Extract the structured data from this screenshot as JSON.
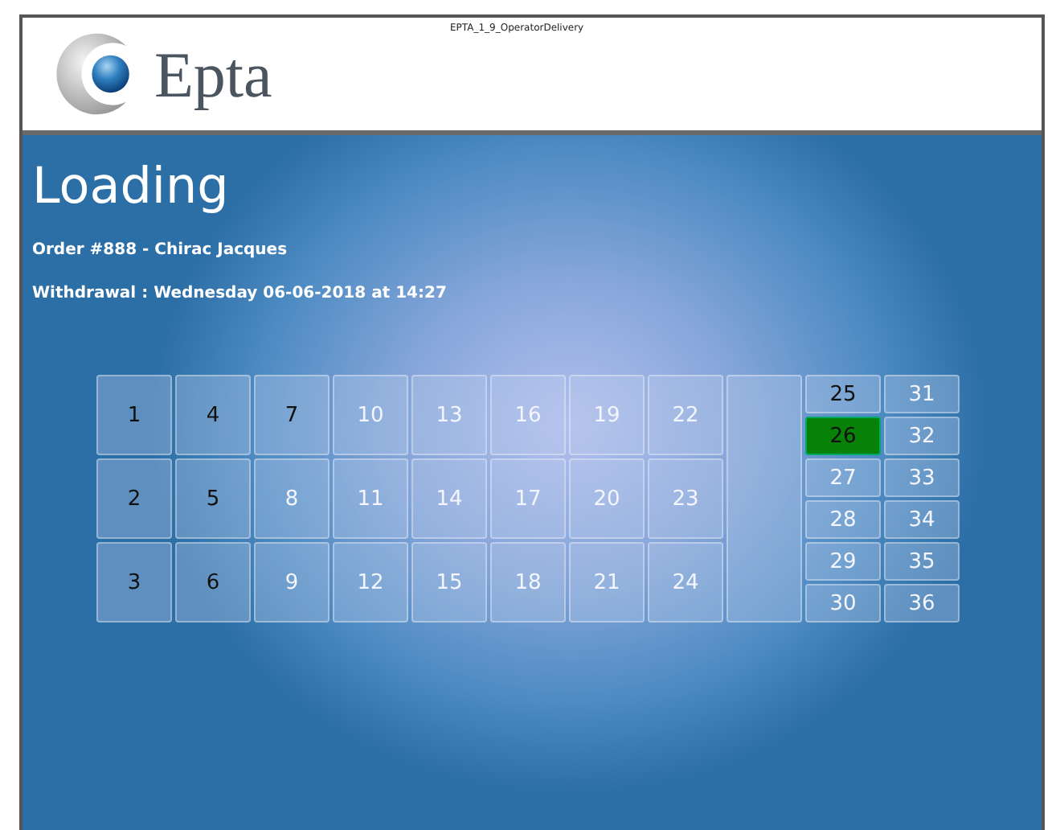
{
  "window": {
    "title": "EPTA_1_9_OperatorDelivery"
  },
  "logo": {
    "text": "Epta"
  },
  "page": {
    "title": "Loading",
    "order": "Order #888 - Chirac Jacques",
    "withdrawal": "Withdrawal : Wednesday 06-06-2018 at 14:27"
  },
  "large_lockers": [
    {
      "label": "1",
      "active": true,
      "selected": false
    },
    {
      "label": "2",
      "active": true,
      "selected": false
    },
    {
      "label": "3",
      "active": true,
      "selected": false
    },
    {
      "label": "4",
      "active": true,
      "selected": false
    },
    {
      "label": "5",
      "active": true,
      "selected": false
    },
    {
      "label": "6",
      "active": true,
      "selected": false
    },
    {
      "label": "7",
      "active": true,
      "selected": false
    },
    {
      "label": "8",
      "active": false,
      "selected": false
    },
    {
      "label": "9",
      "active": false,
      "selected": false
    },
    {
      "label": "10",
      "active": false,
      "selected": false
    },
    {
      "label": "11",
      "active": false,
      "selected": false
    },
    {
      "label": "12",
      "active": false,
      "selected": false
    },
    {
      "label": "13",
      "active": false,
      "selected": false
    },
    {
      "label": "14",
      "active": false,
      "selected": false
    },
    {
      "label": "15",
      "active": false,
      "selected": false
    },
    {
      "label": "16",
      "active": false,
      "selected": false
    },
    {
      "label": "17",
      "active": false,
      "selected": false
    },
    {
      "label": "18",
      "active": false,
      "selected": false
    },
    {
      "label": "19",
      "active": false,
      "selected": false
    },
    {
      "label": "20",
      "active": false,
      "selected": false
    },
    {
      "label": "21",
      "active": false,
      "selected": false
    },
    {
      "label": "22",
      "active": false,
      "selected": false
    },
    {
      "label": "23",
      "active": false,
      "selected": false
    },
    {
      "label": "24",
      "active": false,
      "selected": false
    }
  ],
  "small_lockers": [
    {
      "label": "25",
      "active": true,
      "selected": false
    },
    {
      "label": "26",
      "active": true,
      "selected": true
    },
    {
      "label": "27",
      "active": false,
      "selected": false
    },
    {
      "label": "28",
      "active": false,
      "selected": false
    },
    {
      "label": "29",
      "active": false,
      "selected": false
    },
    {
      "label": "30",
      "active": false,
      "selected": false
    },
    {
      "label": "31",
      "active": false,
      "selected": false
    },
    {
      "label": "32",
      "active": false,
      "selected": false
    },
    {
      "label": "33",
      "active": false,
      "selected": false
    },
    {
      "label": "34",
      "active": false,
      "selected": false
    },
    {
      "label": "35",
      "active": false,
      "selected": false
    },
    {
      "label": "36",
      "active": false,
      "selected": false
    }
  ]
}
